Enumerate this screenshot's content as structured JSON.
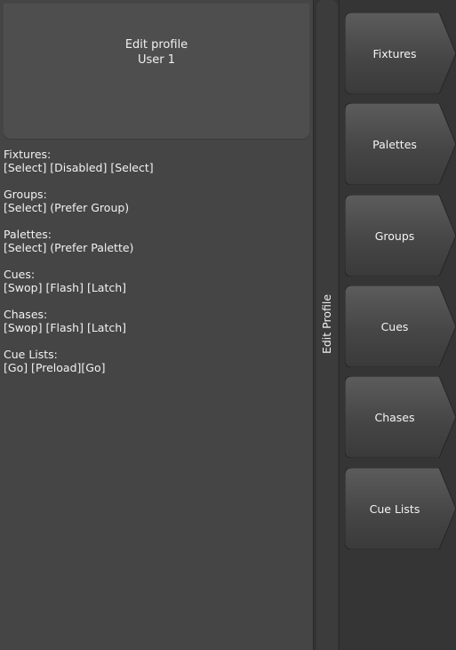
{
  "header": {
    "title": "Edit profile",
    "subtitle": "User 1"
  },
  "info": [
    {
      "label": "Fixtures:",
      "value": "[Select] [Disabled] [Select]"
    },
    {
      "label": "Groups:",
      "value": "[Select] (Prefer Group)"
    },
    {
      "label": "Palettes:",
      "value": "[Select] (Prefer Palette)"
    },
    {
      "label": "Cues:",
      "value": "[Swop] [Flash] [Latch]"
    },
    {
      "label": "Chases:",
      "value": "[Swop] [Flash] [Latch]"
    },
    {
      "label": "Cue Lists:",
      "value": "[Go] [Preload][Go]"
    }
  ],
  "side_tab": {
    "label": "Edit Profile"
  },
  "softkeys": [
    {
      "label": "Fixtures"
    },
    {
      "label": "Palettes"
    },
    {
      "label": "Groups"
    },
    {
      "label": "Cues"
    },
    {
      "label": "Chases"
    },
    {
      "label": "Cue Lists"
    }
  ]
}
